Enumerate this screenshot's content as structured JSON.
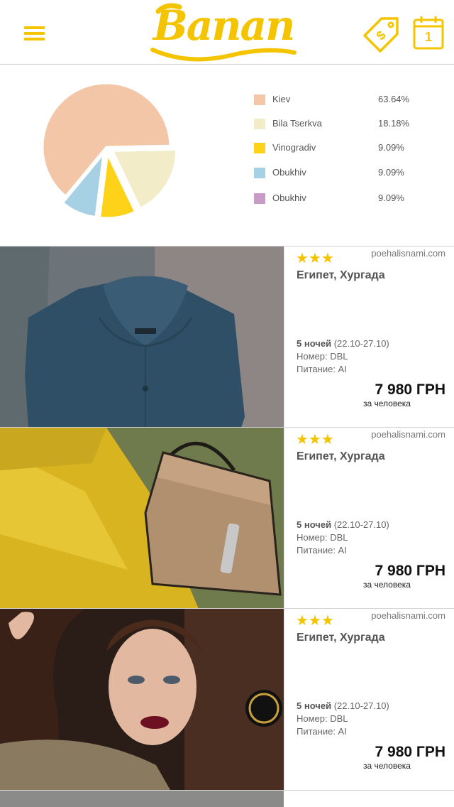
{
  "header": {
    "logo_text": "Banan",
    "calendar_badge": "1"
  },
  "colors": {
    "accent": "#f5c400"
  },
  "icons": {
    "menu": "hamburger-icon",
    "tag": "price-tag-icon",
    "calendar": "calendar-icon"
  },
  "chart_data": {
    "type": "pie",
    "slices": [
      {
        "label": "Kiev",
        "value": 63.64,
        "display": "63.64%",
        "color": "#f2c6a7"
      },
      {
        "label": "Bila Tserkva",
        "value": 18.18,
        "display": "18.18%",
        "color": "#f2ecc8"
      },
      {
        "label": "Vinogradiv",
        "value": 9.09,
        "display": "9.09%",
        "color": "#ffd21a"
      },
      {
        "label": "Obukhiv",
        "value": 9.09,
        "display": "9.09%",
        "color": "#a6d0e3"
      },
      {
        "label": "Obukhiv",
        "value": 9.09,
        "display": "9.09%",
        "color": "#c89cc7"
      }
    ]
  },
  "offers": [
    {
      "stars": "★★★",
      "source": "poehalisnami.com",
      "destination": "Египет, Хургада",
      "nights_bold": "5 ночей",
      "nights_dates": " (22.10-27.10)",
      "room": "Номер: DBL",
      "meal": "Питание: AI",
      "price": "7 980 ГРН",
      "per_person": "за человека",
      "image": "shirt"
    },
    {
      "stars": "★★★",
      "source": "poehalisnami.com",
      "destination": "Египет, Хургада",
      "nights_bold": "5 ночей",
      "nights_dates": " (22.10-27.10)",
      "room": "Номер: DBL",
      "meal": "Питание: AI",
      "price": "7 980 ГРН",
      "per_person": "за человека",
      "image": "bag"
    },
    {
      "stars": "★★★",
      "source": "poehalisnami.com",
      "destination": "Египет, Хургада",
      "nights_bold": "5 ночей",
      "nights_dates": " (22.10-27.10)",
      "room": "Номер: DBL",
      "meal": "Питание: AI",
      "price": "7 980 ГРН",
      "per_person": "за человека",
      "image": "portrait"
    }
  ]
}
